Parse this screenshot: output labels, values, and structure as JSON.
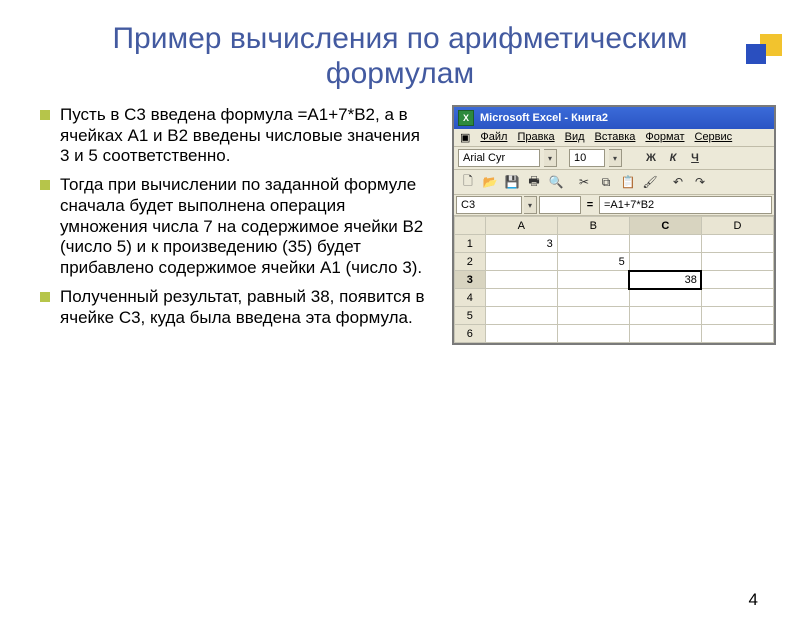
{
  "slide": {
    "title": "Пример вычисления по арифметическим формулам",
    "page_number": "4"
  },
  "bullets": [
    "Пусть в С3 введена формула =А1+7*В2, а в ячейках А1 и В2 введены числовые значения 3 и 5 соответственно.",
    "Тогда при вычислении по заданной формуле сначала будет выполнена операция умножения числа 7 на содержимое ячейки В2 (число 5) и к произведению (35) будет прибавлено содержимое ячейки А1 (число 3).",
    "Полученный результат, равный 38, появится в ячейке С3, куда была введена эта формула."
  ],
  "excel": {
    "title": "Microsoft Excel - Книга2",
    "menus": [
      "Файл",
      "Правка",
      "Вид",
      "Вставка",
      "Формат",
      "Сервис"
    ],
    "font_name": "Arial Cyr",
    "font_size": "10",
    "fmt_bold": "Ж",
    "fmt_italic": "К",
    "fmt_under": "Ч",
    "name_box": "C3",
    "formula": "=A1+7*B2",
    "columns": [
      "A",
      "B",
      "C",
      "D"
    ],
    "rows": [
      {
        "n": "1",
        "A": "3",
        "B": "",
        "C": "",
        "D": ""
      },
      {
        "n": "2",
        "A": "",
        "B": "5",
        "C": "",
        "D": ""
      },
      {
        "n": "3",
        "A": "",
        "B": "",
        "C": "38",
        "D": ""
      },
      {
        "n": "4",
        "A": "",
        "B": "",
        "C": "",
        "D": ""
      },
      {
        "n": "5",
        "A": "",
        "B": "",
        "C": "",
        "D": ""
      },
      {
        "n": "6",
        "A": "",
        "B": "",
        "C": "",
        "D": ""
      }
    ],
    "selected_cell": "C3"
  }
}
